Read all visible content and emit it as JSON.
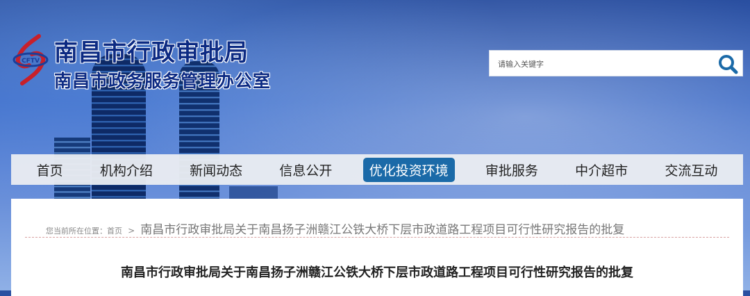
{
  "header": {
    "title": "南昌市行政审批局",
    "subtitle": "南昌市政务服务管理办公室"
  },
  "search": {
    "placeholder": "请输入关键字"
  },
  "nav": {
    "items": [
      {
        "label": "首页"
      },
      {
        "label": "机构介绍"
      },
      {
        "label": "新闻动态"
      },
      {
        "label": "信息公开"
      },
      {
        "label": "优化投资环境",
        "active": true
      },
      {
        "label": "审批服务"
      },
      {
        "label": "中介超市"
      },
      {
        "label": "交流互动"
      }
    ]
  },
  "breadcrumb": {
    "prefix": "您当前所在位置：",
    "home": "首页",
    "separator": ">",
    "current": "南昌市行政审批局关于南昌扬子洲赣江公铁大桥下层市政道路工程项目可行性研究报告的批复"
  },
  "article": {
    "title": "南昌市行政审批局关于南昌扬子洲赣江公铁大桥下层市政道路工程项目可行性研究报告的批复"
  },
  "colors": {
    "accent": "#1b6aa8",
    "brand": "#0c2a83"
  }
}
